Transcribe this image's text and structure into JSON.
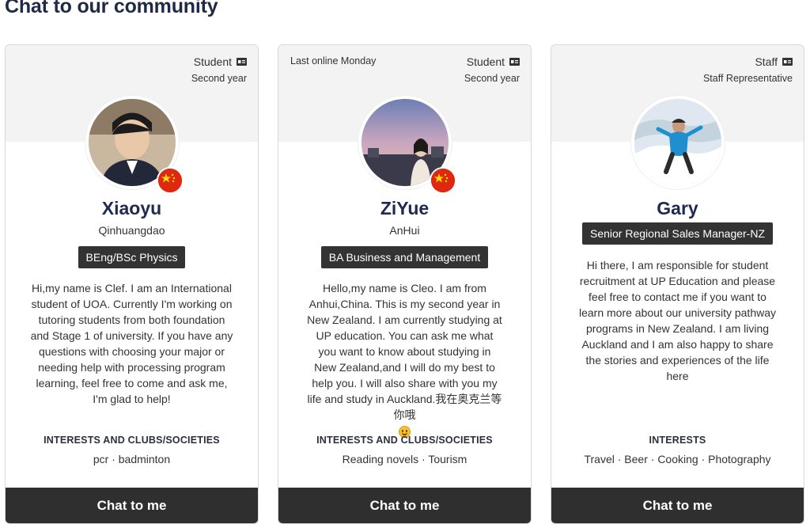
{
  "page": {
    "heading": "Chat to our community"
  },
  "cards": [
    {
      "last_online": "",
      "role": "Student",
      "role_detail": "Second year",
      "name": "Xiaoyu",
      "location": "Qinhuangdao",
      "program": "BEng/BSc Physics",
      "bio": "Hi,my name is Clef. I am an International student of UOA. Currently I'm working on tutoring students from both foundation and Stage 1 of university. If you have any questions with choosing your major or needing help with processing program learning, feel free to come and ask me, I'm glad to help!",
      "interests_title": "INTERESTS AND CLUBS/SOCIETIES",
      "interests": "pcr · badminton",
      "button": "Chat to me",
      "flag": "china-flag-icon"
    },
    {
      "last_online": "Last online Monday",
      "role": "Student",
      "role_detail": "Second year",
      "name": "ZiYue",
      "location": "AnHui",
      "program": "BA Business and Management",
      "bio": "Hello,my name is Cleo. I am from Anhui,China. This is my second year in New Zealand. I am currently studying at UP education. You can ask me what you want to know about studying in New Zealand,and I will do my best to help you. I will also share with you my life and study in Auckland.我在奥克兰等你哦",
      "interests_title": "INTERESTS AND CLUBS/SOCIETIES",
      "interests": "Reading novels · Tourism",
      "button": "Chat to me",
      "flag": "china-flag-icon"
    },
    {
      "last_online": "",
      "role": "Staff",
      "role_detail": "Staff Representative",
      "name": "Gary",
      "location": "",
      "program": "Senior Regional Sales Manager-NZ",
      "bio": "Hi there, I am responsible for student recruitment at UP Education and please feel free to contact me if you want to learn more about our university pathway programs in New Zealand. I am living Auckland and I am also happy to share the stories and experiences of the life here",
      "interests_title": "INTERESTS",
      "interests": "Travel · Beer · Cooking · Photography",
      "button": "Chat to me",
      "flag": ""
    }
  ],
  "colors": {
    "button_bg": "#2f2f2f",
    "name": "#1f2a50",
    "header_bg": "#f3f3f3"
  },
  "icons": {
    "role": "id-card-icon",
    "emoji": "smiling-face-icon"
  }
}
